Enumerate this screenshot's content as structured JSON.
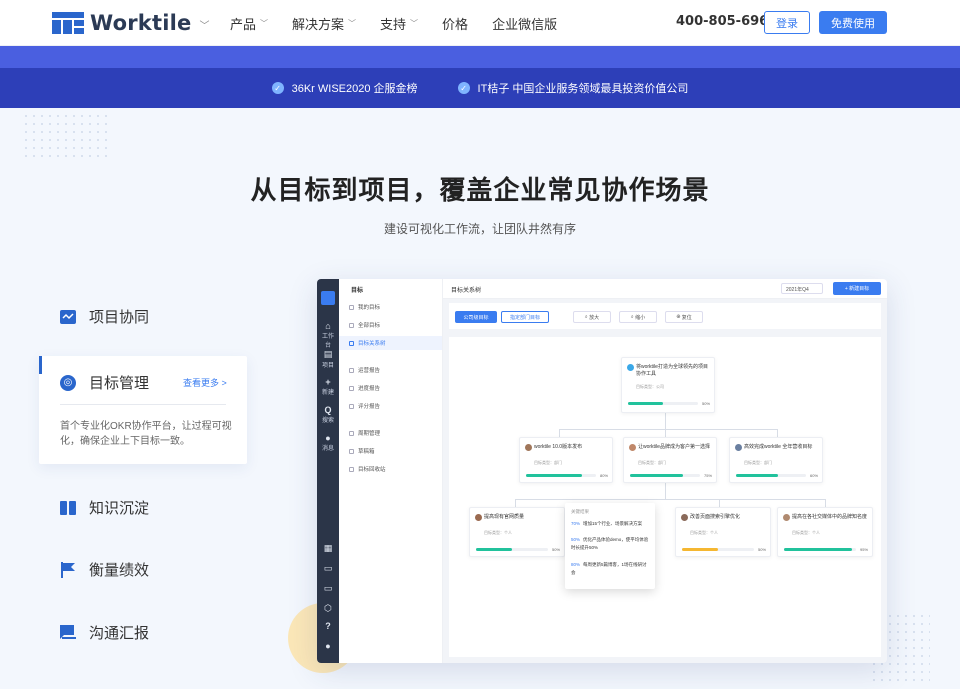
{
  "header": {
    "logo_text": "Worktile",
    "nav": [
      {
        "label": "产品",
        "caret": true
      },
      {
        "label": "解决方案",
        "caret": true
      },
      {
        "label": "支持",
        "caret": true
      },
      {
        "label": "价格",
        "caret": false
      },
      {
        "label": "企业微信版",
        "caret": false
      }
    ],
    "phone": "400-805-6966",
    "login_label": "登录",
    "free_label": "免费使用"
  },
  "banner": {
    "badges": [
      "36Kr WISE2020 企服金榜",
      "IT桔子 中国企业服务领域最具投资价值公司"
    ]
  },
  "hero": {
    "title": "从目标到项目，覆盖企业常见协作场景",
    "subtitle": "建设可视化工作流，让团队井然有序"
  },
  "features": {
    "items": [
      {
        "label": "项目协同",
        "icon": "project-icon"
      },
      {
        "label": "知识沉淀",
        "icon": "book-icon"
      },
      {
        "label": "衡量绩效",
        "icon": "flag-icon"
      },
      {
        "label": "沟通汇报",
        "icon": "chat-icon"
      }
    ],
    "active": {
      "label": "目标管理",
      "icon": "target-icon",
      "more": "查看更多 >",
      "desc": "首个专业化OKR协作平台，让过程可视化，确保企业上下目标一致。"
    }
  },
  "app": {
    "rail": [
      "工作台",
      "项目",
      "新建",
      "搜索",
      "消息"
    ],
    "sidebar": {
      "title": "目标",
      "items": [
        "我的目标",
        "全部目标",
        "目标关系树",
        "运营报告",
        "进度报告",
        "评分报告",
        "周期管理",
        "草稿箱",
        "目标回收站"
      ],
      "active_index": 2
    },
    "main_title": "目标关系树",
    "quarter": "2021年Q4",
    "new_button": "+ 新建目标",
    "tabs": [
      "公司级目标",
      "指定部门目标"
    ],
    "tools": [
      "放大",
      "缩小",
      "复位"
    ],
    "root_node": {
      "title": "将worktile打造为全球领先的项目协作工具",
      "meta": "目标类型：公司",
      "progress": 50,
      "pct": "50%"
    },
    "mid_nodes": [
      {
        "title": "worktile 10.0版本发布",
        "meta": "目标类型：部门",
        "progress": 80,
        "pct": "80%"
      },
      {
        "title": "让worktile品牌成为客户第一选择",
        "meta": "目标类型：部门",
        "progress": 75,
        "pct": "75%"
      },
      {
        "title": "高效完成worktile 全年营收目标",
        "meta": "目标类型：部门",
        "progress": 60,
        "pct": "60%"
      }
    ],
    "leaf_nodes": [
      {
        "title": "提高现有官网质量",
        "meta": "目标类型：个人",
        "progress": 50,
        "pct": "50%"
      },
      {
        "title": "改善页面搜索引擎优化",
        "meta": "目标类型：个人",
        "progress": 50,
        "pct": "50%"
      },
      {
        "title": "提高在各社交媒体中的品牌知名度",
        "meta": "目标类型：个人",
        "progress": 95,
        "pct": "95%"
      }
    ],
    "popup": {
      "header": "关键结果",
      "rows": [
        {
          "pct": "70%",
          "text": "增加15个行业、场景解决方案"
        },
        {
          "pct": "50%",
          "text": "优化产品体验demo，使平均体验时长提升50%"
        },
        {
          "pct": "80%",
          "text": "每周更新5篇博客，1场在线研讨会"
        }
      ]
    }
  }
}
